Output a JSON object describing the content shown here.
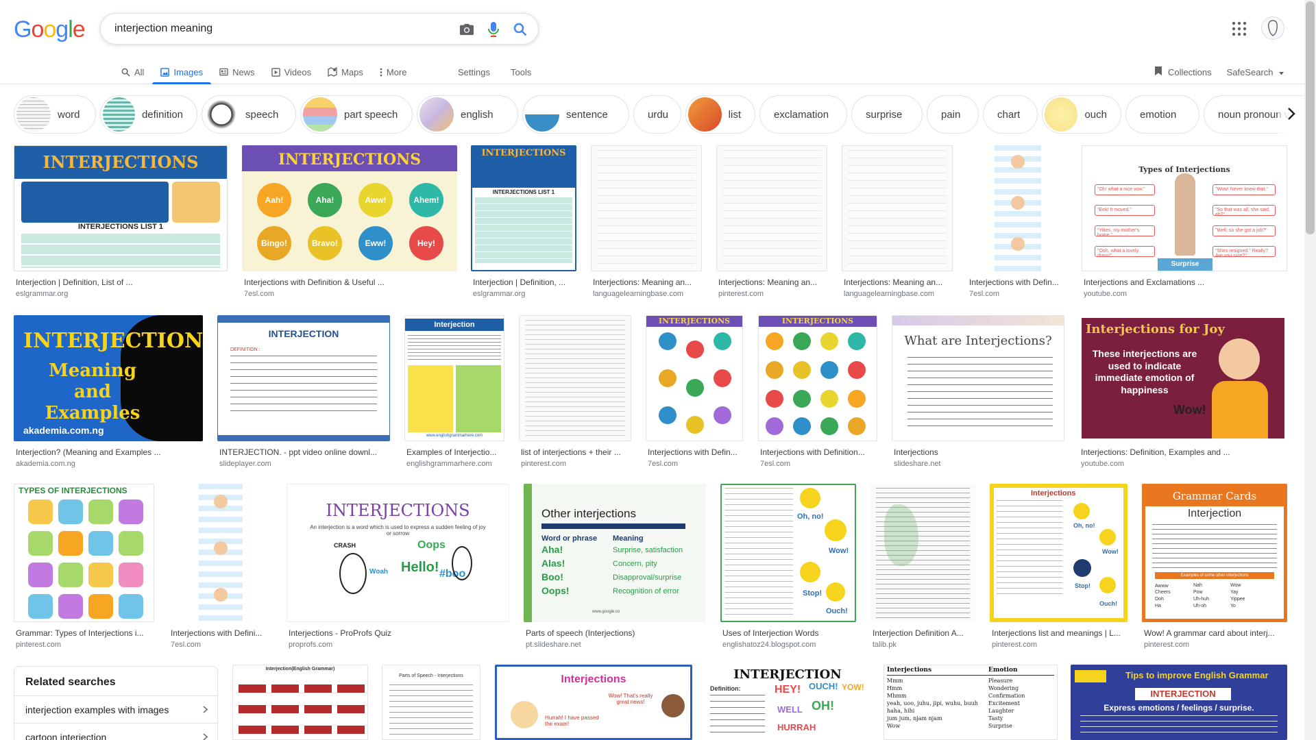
{
  "logo": "Google",
  "search": {
    "query": "interjection meaning"
  },
  "tabs": [
    {
      "label": "All",
      "icon": "search-icon"
    },
    {
      "label": "Images",
      "icon": "image-icon",
      "active": true
    },
    {
      "label": "News",
      "icon": "news-icon"
    },
    {
      "label": "Videos",
      "icon": "video-icon"
    },
    {
      "label": "Maps",
      "icon": "map-icon"
    },
    {
      "label": "More",
      "icon": "more-vert-icon"
    }
  ],
  "tools": {
    "settings": "Settings",
    "tools": "Tools"
  },
  "right": {
    "collections": "Collections",
    "safesearch": "SafeSearch"
  },
  "chips": [
    "word",
    "definition",
    "speech",
    "part speech",
    "english",
    "sentence",
    "urdu",
    "list",
    "exclamation",
    "surprise",
    "pain",
    "chart",
    "ouch",
    "emotion",
    "noun pronoun verb adje"
  ],
  "results": [
    {
      "caption": "Interjection | Definition, List of ...",
      "source": "eslgrammar.org",
      "img_text": "INTERJECTIONS",
      "sub": "INTERJECTIONS LIST 1"
    },
    {
      "caption": "Interjections with Definition & Useful ...",
      "source": "7esl.com",
      "img_text": "INTERJECTIONS",
      "bubbles": [
        "Aah!",
        "Aha!",
        "Aww!",
        "Ahem!",
        "Bingo!",
        "Bravo!",
        "Eww!",
        "Hey!"
      ]
    },
    {
      "caption": "Interjection | Definition, ...",
      "source": "eslgrammar.org",
      "img_text": "INTERJECTIONS",
      "sub": "INTERJECTIONS LIST 1"
    },
    {
      "caption": "Interjections: Meaning an...",
      "source": "languagelearningbase.com"
    },
    {
      "caption": "Interjections: Meaning an...",
      "source": "pinterest.com"
    },
    {
      "caption": "Interjections: Meaning an...",
      "source": "languagelearningbase.com"
    },
    {
      "caption": "Interjections with Defin...",
      "source": "7esl.com"
    },
    {
      "caption": "Interjections and Exclamations ...",
      "source": "youtube.com",
      "img_text": "Types of Interjections",
      "quotes": [
        "\"Oh! what a nice vow.\"",
        "\"Wow! Never knew that.\"",
        "\"Eek! It moved.\"",
        "\"So that was all, she said, eh?\"",
        "\"Yikes, my mother's home.\"",
        "\"Well, so she got a job?\"",
        "\"Ooh, what a lovely dress!\"",
        "\"Shes resigned.\" Really? Are you sure?\""
      ],
      "footer": "Surprise"
    },
    {
      "caption": "Interjection? (Meaning and Examples ...",
      "source": "akademia.com.ng",
      "img_text": "INTERJECTIONS",
      "sub": "Meaning and Examples",
      "footer": "akademia.com.ng"
    },
    {
      "caption": "INTERJECTION. - ppt video online downl...",
      "source": "slideplayer.com",
      "img_text": "INTERJECTION",
      "sub": "DEFINITION :"
    },
    {
      "caption": "Examples of Interjectio...",
      "source": "englishgrammarhere.com",
      "img_text": "Interjection",
      "footer": "www.englishgrammarhere.com"
    },
    {
      "caption": "list of interjections + their ...",
      "source": "pinterest.com"
    },
    {
      "caption": "Interjections with Defin...",
      "source": "7esl.com",
      "img_text": "INTERJECTIONS"
    },
    {
      "caption": "Interjections with Definition...",
      "source": "7esl.com",
      "img_text": "INTERJECTIONS"
    },
    {
      "caption": "Interjections",
      "source": "slideshare.net",
      "img_text": "What are Interjections?"
    },
    {
      "caption": "Interjections: Definition, Examples and ...",
      "source": "youtube.com",
      "img_text": "Interjections for Joy",
      "sub": "These interjections are used to indicate immediate emotion of happiness",
      "footer": "Wow!"
    },
    {
      "caption": "Grammar: Types of Interjections i...",
      "source": "pinterest.com",
      "img_text": "TYPES OF INTERJECTIONS"
    },
    {
      "caption": "Interjections with Defini...",
      "source": "7esl.com"
    },
    {
      "caption": "Interjections - ProProfs Quiz",
      "source": "proprofs.com",
      "img_text": "INTERJECTIONS",
      "sub": "An interjection is a word which is used to express a sudden feeling of joy or sorrow",
      "bubbles": [
        "CRASH",
        "Oops",
        "Hello!",
        "#boo",
        "Woah"
      ]
    },
    {
      "caption": "Parts of speech (Interjections)",
      "source": "pt.slideshare.net",
      "img_text": "Other interjections",
      "table_head": [
        "Word or phrase",
        "Meaning"
      ],
      "rows": [
        [
          "Aha!",
          "Surprise, satisfaction"
        ],
        [
          "Alas!",
          "Concern, pity"
        ],
        [
          "Boo!",
          "Disapproval/surprise"
        ],
        [
          "Oops!",
          "Recognition of error"
        ]
      ],
      "footer": "www.google.co"
    },
    {
      "caption": "Uses of Interjection Words",
      "source": "englishatoz24.blogspot.com",
      "bubbles": [
        "Oh, no!",
        "Wow!",
        "Stop!",
        "Ouch!"
      ]
    },
    {
      "caption": "Interjection Definition A...",
      "source": "talib.pk"
    },
    {
      "caption": "Interjections list and meanings | L...",
      "source": "pinterest.com",
      "img_text": "Interjections",
      "bubbles": [
        "Oh, no!",
        "Wow!",
        "Stop!",
        "Ouch!"
      ]
    },
    {
      "caption": "Wow! A grammar card about interj...",
      "source": "pinterest.com",
      "img_text": "Grammar Cards",
      "sub": "Interjection",
      "footer": "Examples of some other interjections",
      "words": [
        "Awww",
        "Nah",
        "Wow",
        "Cheers",
        "Pow",
        "Yay",
        "Doh",
        "Uh-huh",
        "Yippee",
        "Ha",
        "Uh-oh",
        "Yo"
      ]
    },
    {
      "img_text": "Interjection(English Grammar)"
    },
    {
      "img_text": "Parts of Speech - Interjections"
    },
    {
      "img_text": "Interjections",
      "sub": "Wow! That's really great news!",
      "footer": "Hurrah! I have passed the exam!"
    },
    {
      "img_text": "INTERJECTION",
      "sub": "Definition:",
      "bubbles": [
        "HEY!",
        "OUCH!",
        "YOW!",
        "OH!",
        "WELL",
        "HURRAH"
      ]
    },
    {
      "img_text": "Interjections",
      "sub": "Emotion",
      "words_l": [
        "Mmm",
        "Hmm",
        "Mhmm",
        "yeah, uoo, juhu, jipi, wuhu, buuh",
        "haha, hihi",
        "jum jum, njam njam",
        "Wow"
      ],
      "words_r": [
        "Pleasure",
        "Wondering",
        "Confirmation",
        "Excitement",
        "Laughter",
        "Tasty",
        "Surprise"
      ]
    },
    {
      "img_text": "Tips to improve English Grammar",
      "sub": "INTERJECTION",
      "footer": "Express emotions / feelings / surprise."
    }
  ],
  "related": {
    "title": "Related searches",
    "items": [
      "interjection examples with images",
      "cartoon interjection"
    ]
  },
  "colors": {
    "accent": "#1a73e8",
    "link_gray": "#70757a"
  }
}
